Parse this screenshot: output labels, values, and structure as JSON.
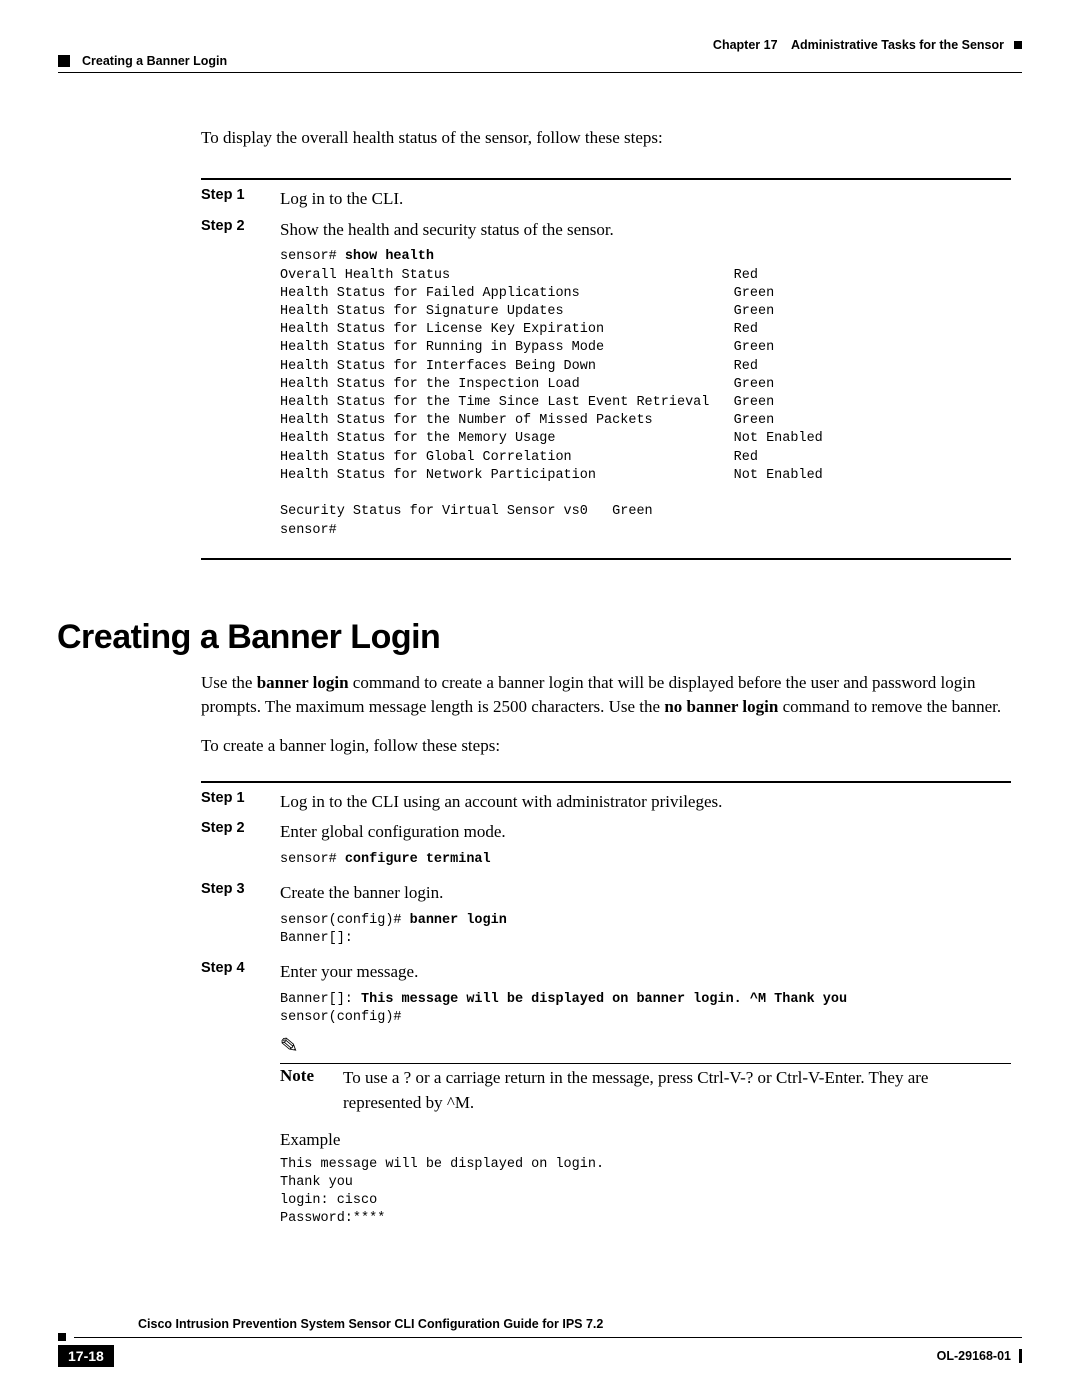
{
  "header": {
    "chapter_label": "Chapter 17",
    "chapter_title": "Administrative Tasks for the Sensor",
    "section_crumb": "Creating a Banner Login"
  },
  "section1": {
    "intro": "To display the overall health status of the sensor, follow these steps:",
    "step1_label": "Step 1",
    "step1_text": "Log in to the CLI.",
    "step2_label": "Step 2",
    "step2_text": "Show the health and security status of the sensor.",
    "cli_prompt": "sensor# ",
    "cli_cmd": "show health",
    "cli_output": "Overall Health Status                                   Red\nHealth Status for Failed Applications                   Green\nHealth Status for Signature Updates                     Green\nHealth Status for License Key Expiration                Red\nHealth Status for Running in Bypass Mode                Green\nHealth Status for Interfaces Being Down                 Red\nHealth Status for the Inspection Load                   Green\nHealth Status for the Time Since Last Event Retrieval   Green\nHealth Status for the Number of Missed Packets          Green\nHealth Status for the Memory Usage                      Not Enabled\nHealth Status for Global Correlation                    Red\nHealth Status for Network Participation                 Not Enabled\n\nSecurity Status for Virtual Sensor vs0   Green\nsensor#"
  },
  "section2": {
    "title": "Creating a Banner Login",
    "para1_a": "Use the ",
    "para1_b_cmd1": "banner login",
    "para1_c": " command to create a banner login that will be displayed before the user and password login prompts. The maximum message length is 2500 characters. Use the ",
    "para1_b_cmd2": "no banner login",
    "para1_e": " command to remove the banner.",
    "para2": "To create a banner login, follow these steps:",
    "step1_label": "Step 1",
    "step1_text": "Log in to the CLI using an account with administrator privileges.",
    "step2_label": "Step 2",
    "step2_text": "Enter global configuration mode.",
    "step2_cli_prompt": "sensor# ",
    "step2_cli_cmd": "configure terminal",
    "step3_label": "Step 3",
    "step3_text": "Create the banner login.",
    "step3_cli_prompt": "sensor(config)# ",
    "step3_cli_cmd": "banner login",
    "step3_cli_out": "Banner[]:",
    "step4_label": "Step 4",
    "step4_text": "Enter your message.",
    "step4_cli_prompt": "Banner[]: ",
    "step4_cli_cmd": "This message will be displayed on banner login. ^M Thank you",
    "step4_cli_out": "sensor(config)#",
    "note_label": "Note",
    "note_a": "To use a ? or a carriage return in the message, press ",
    "note_b1": "Ctrl-V-?",
    "note_c": " or ",
    "note_b2": "Ctrl-V-Enter",
    "note_d": ". They are represented by ^M.",
    "example_label": "Example",
    "example_cli": "This message will be displayed on login.\nThank you\nlogin: cisco\nPassword:****"
  },
  "footer": {
    "guide_title": "Cisco Intrusion Prevention System Sensor CLI Configuration Guide for IPS 7.2",
    "page_number": "17-18",
    "doc_id": "OL-29168-01"
  }
}
